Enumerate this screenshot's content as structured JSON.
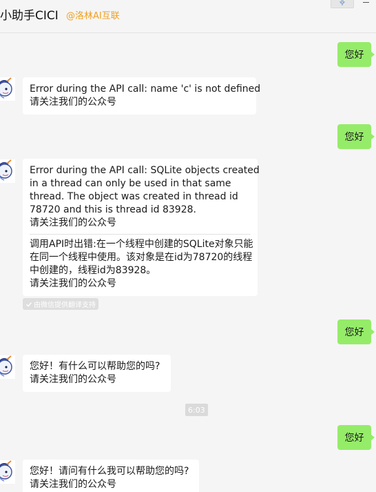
{
  "header": {
    "title": "小助手CICI",
    "org": "@洛林AI互联"
  },
  "messages": {
    "out1": "您好",
    "in1": {
      "lines": [
        "Error during the API call: name 'c' is not defined",
        "请关注我们的公众号"
      ]
    },
    "out2": "您好",
    "in2": {
      "lines": [
        "Error during the API call: SQLite objects created",
        "in a thread can only be used in that same",
        "thread. The object was created in thread id",
        "78720 and this is thread id 83928.",
        "请关注我们的公众号"
      ],
      "translation": [
        "调用API时出错:在一个线程中创建的SQLite对象只能",
        "在同一个线程中使用。该对象是在id为78720的线程",
        "中创建的，线程id为83928。",
        "请关注我们的公众号"
      ]
    },
    "translate_badge": "由微信提供翻译支持",
    "out3": "您好",
    "in3": {
      "lines": [
        "您好！有什么可以帮助您的吗?",
        "请关注我们的公众号"
      ]
    },
    "timestamp": "6:03",
    "out4": "您好",
    "in4": {
      "lines": [
        "您好！请问有什么我可以帮助您的吗?",
        "请关注我们的公众号"
      ]
    }
  },
  "colors": {
    "outgoing_bubble": "#95ec69",
    "incoming_bubble": "#ffffff",
    "org_text": "#f0a020",
    "background": "#f5f5f5"
  }
}
